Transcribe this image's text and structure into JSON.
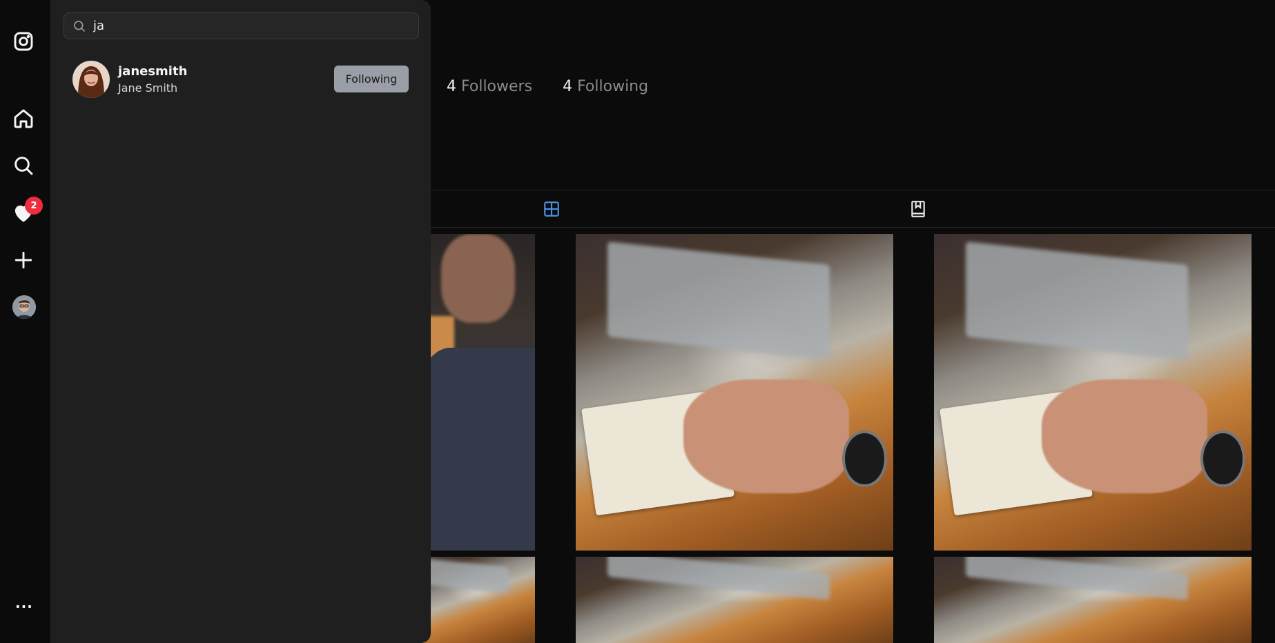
{
  "sidebar": {
    "items": [
      {
        "icon": "instagram-logo-icon",
        "label": ""
      },
      {
        "icon": "home-icon",
        "label": ""
      },
      {
        "icon": "search-icon",
        "label": ""
      },
      {
        "icon": "heart-icon",
        "label": ""
      },
      {
        "icon": "plus-icon",
        "label": ""
      },
      {
        "icon": "avatar",
        "label": ""
      }
    ],
    "notification_count": "2",
    "more_label": "..."
  },
  "search": {
    "query": "ja",
    "results": [
      {
        "username": "janesmith",
        "full_name": "Jane Smith",
        "button_label": "Following"
      }
    ]
  },
  "profile": {
    "followers_count": "4",
    "followers_label": "Followers",
    "following_count": "4",
    "following_label": "Following"
  },
  "tabs": {
    "active": "posts",
    "items": [
      {
        "name": "posts",
        "icon": "grid-icon",
        "color": "#4a90e2"
      },
      {
        "name": "saved",
        "icon": "bookmark-icon",
        "color": "#e8e8e8"
      }
    ]
  },
  "colors": {
    "background": "#0b0b0b",
    "panel": "#1f1f1f",
    "badge": "#ef2d3d",
    "accent": "#4a90e2",
    "button": "#9a9ea6"
  }
}
